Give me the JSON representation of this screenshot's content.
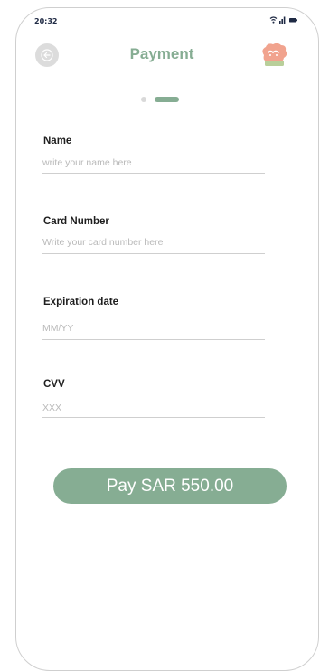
{
  "status": {
    "time": "20:32"
  },
  "header": {
    "title": "Payment"
  },
  "form": {
    "name": {
      "label": "Name",
      "placeholder": "write your name here"
    },
    "card_number": {
      "label": "Card Number",
      "placeholder": "Write your card number here"
    },
    "expiration": {
      "label": "Expiration date",
      "placeholder": "MM/YY"
    },
    "cvv": {
      "label": "CVV",
      "placeholder": "XXX"
    }
  },
  "pay_button": {
    "label": "Pay SAR 550.00"
  },
  "steps": {
    "current": 2,
    "total": 2
  },
  "colors": {
    "accent": "#86ad93",
    "muted": "#d9d9d9"
  },
  "icons": [
    "back-arrow-icon",
    "wifi-icon",
    "signal-icon",
    "battery-icon",
    "brand-logo"
  ]
}
